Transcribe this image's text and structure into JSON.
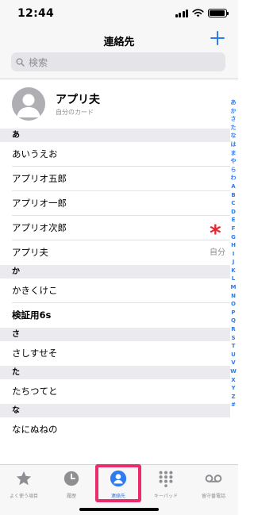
{
  "status": {
    "time": "12:44",
    "battery_level": 0.95
  },
  "nav": {
    "title": "連絡先",
    "search_placeholder": "検索"
  },
  "my_card": {
    "name": "アプリ夫",
    "subtitle": "自分のカード"
  },
  "sections": [
    {
      "header": "あ",
      "rows": [
        {
          "name": "あいうえお"
        },
        {
          "name": "アプリオ五郎"
        },
        {
          "name": "アプリオ一郎"
        },
        {
          "name": "アプリオ次郎"
        },
        {
          "name": "アプリ夫",
          "note": "自分"
        }
      ]
    },
    {
      "header": "か",
      "rows": [
        {
          "name": "かきくけこ"
        },
        {
          "name": "検証用6s",
          "bold": true
        }
      ]
    },
    {
      "header": "さ",
      "rows": [
        {
          "name": "さしすせそ"
        }
      ]
    },
    {
      "header": "た",
      "rows": [
        {
          "name": "たちつてと"
        }
      ]
    },
    {
      "header": "な",
      "rows": [
        {
          "name": "なにぬねの"
        }
      ]
    }
  ],
  "annotation": "*",
  "index": [
    "あ",
    "か",
    "さ",
    "た",
    "な",
    "は",
    "ま",
    "や",
    "ら",
    "わ",
    "A",
    "B",
    "C",
    "D",
    "E",
    "F",
    "G",
    "H",
    "I",
    "J",
    "K",
    "L",
    "M",
    "N",
    "O",
    "P",
    "Q",
    "R",
    "S",
    "T",
    "U",
    "V",
    "W",
    "X",
    "Y",
    "Z",
    "#"
  ],
  "tabs": [
    {
      "label": "よく使う項目",
      "icon": "star-icon"
    },
    {
      "label": "履歴",
      "icon": "clock-icon"
    },
    {
      "label": "連絡先",
      "icon": "contacts-icon",
      "active": true
    },
    {
      "label": "キーパッド",
      "icon": "keypad-icon"
    },
    {
      "label": "留守番電話",
      "icon": "voicemail-icon"
    }
  ],
  "colors": {
    "accent": "#2f7bf0",
    "highlight": "#ea2b6d",
    "annotation": "#e8262f",
    "section_bg": "#ebebef"
  }
}
